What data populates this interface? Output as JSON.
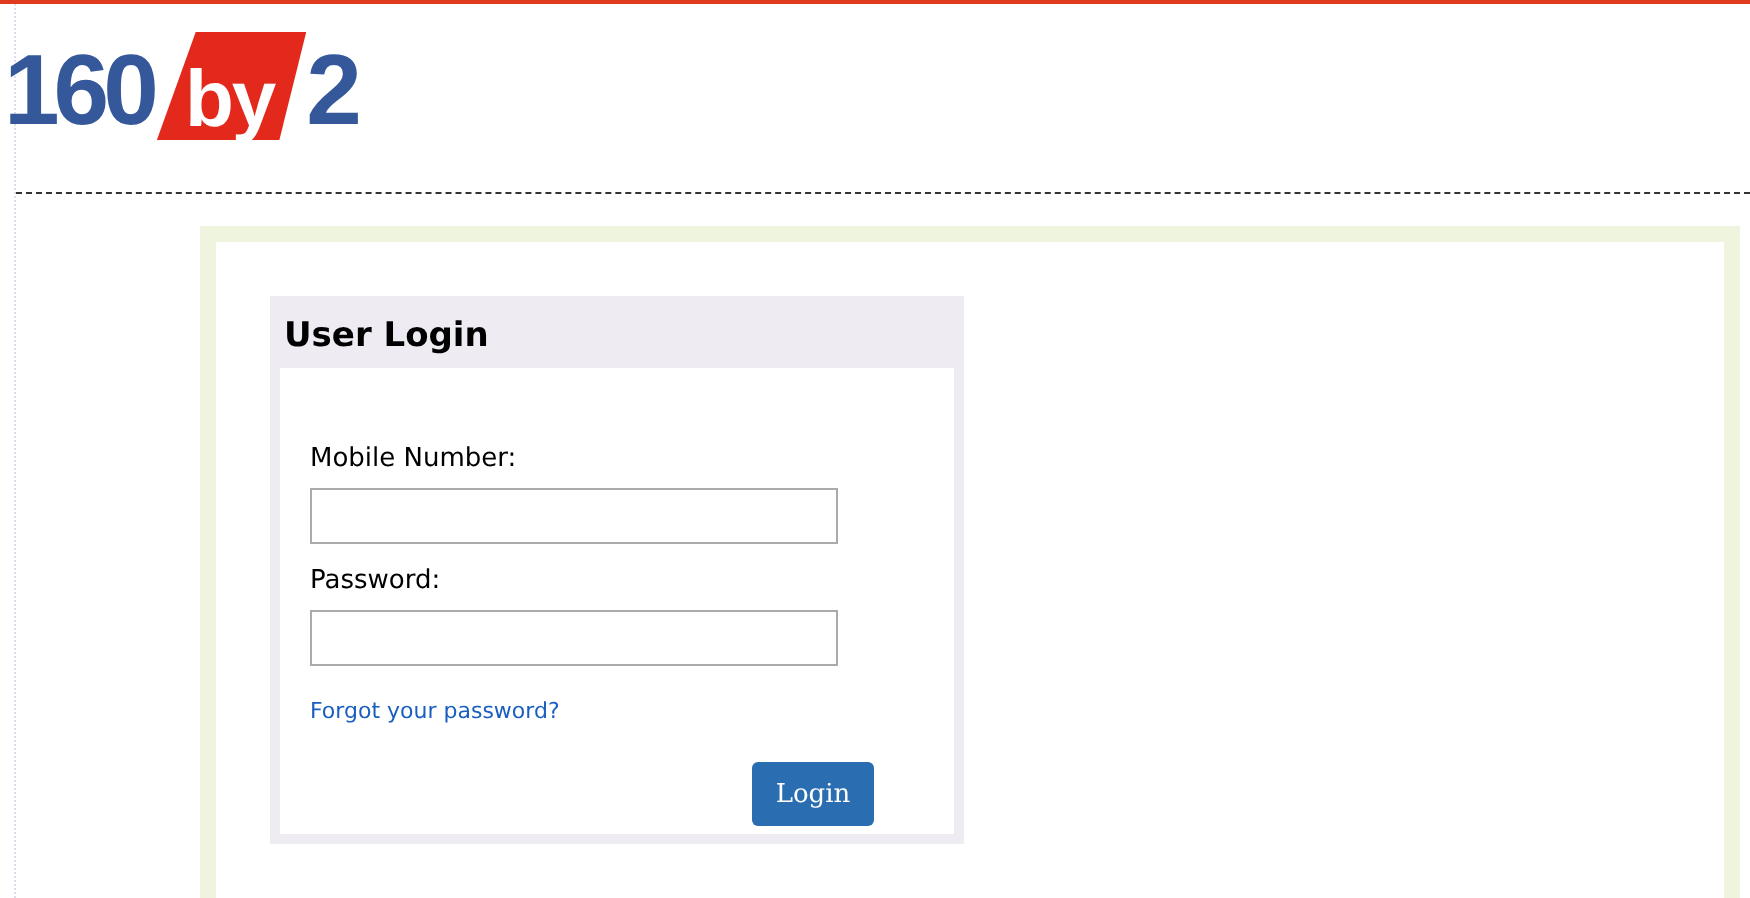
{
  "logo": {
    "parts": [
      "160",
      "by",
      "2"
    ]
  },
  "login": {
    "title": "User Login",
    "fields": [
      {
        "label": "Mobile Number:"
      },
      {
        "label": "Password:"
      }
    ],
    "forgot_link": "Forgot your password?",
    "submit": "Login"
  }
}
